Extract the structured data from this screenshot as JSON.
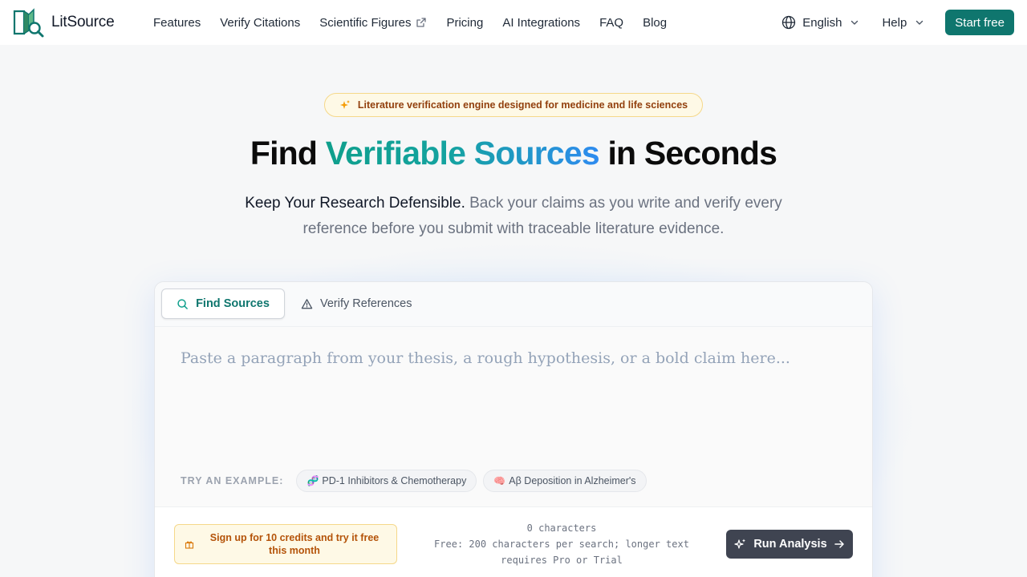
{
  "brand": {
    "name": "LitSource"
  },
  "nav": {
    "items": [
      {
        "label": "Features"
      },
      {
        "label": "Verify Citations"
      },
      {
        "label": "Scientific Figures",
        "external": true
      },
      {
        "label": "Pricing"
      },
      {
        "label": "AI Integrations"
      },
      {
        "label": "FAQ"
      },
      {
        "label": "Blog"
      }
    ],
    "language": "English",
    "help": "Help",
    "cta": "Start free"
  },
  "hero": {
    "badge": "Literature verification engine designed for medicine and life sciences",
    "title_pre": "Find ",
    "title_highlight": "Verifiable Sources",
    "title_post": " in Seconds",
    "subtitle_strong": "Keep Your Research Defensible.",
    "subtitle_rest": " Back your claims as you write and verify every reference before you submit with traceable literature evidence."
  },
  "card": {
    "tabs": [
      {
        "label": "Find Sources",
        "icon": "search-icon",
        "active": true
      },
      {
        "label": "Verify References",
        "icon": "warning-icon",
        "active": false
      }
    ],
    "input": {
      "value": "",
      "placeholder": "Paste a paragraph from your thesis, a rough hypothesis, or a bold claim here..."
    },
    "examples_label": "TRY AN EXAMPLE:",
    "examples": [
      {
        "emoji": "🧬",
        "label": "PD-1 Inhibitors & Chemotherapy"
      },
      {
        "emoji": "🧠",
        "label": "Aβ Deposition in Alzheimer's"
      }
    ],
    "promo": "Sign up for 10 credits and try it free this month",
    "char_count": "0 characters",
    "limit_note": "Free: 200 characters per search; longer text requires Pro or Trial",
    "run_button": "Run Analysis"
  },
  "colors": {
    "brand_teal": "#0f766e",
    "badge_bg": "#fef9e6",
    "promo_text": "#b45309",
    "run_button_bg": "#3f4451"
  }
}
